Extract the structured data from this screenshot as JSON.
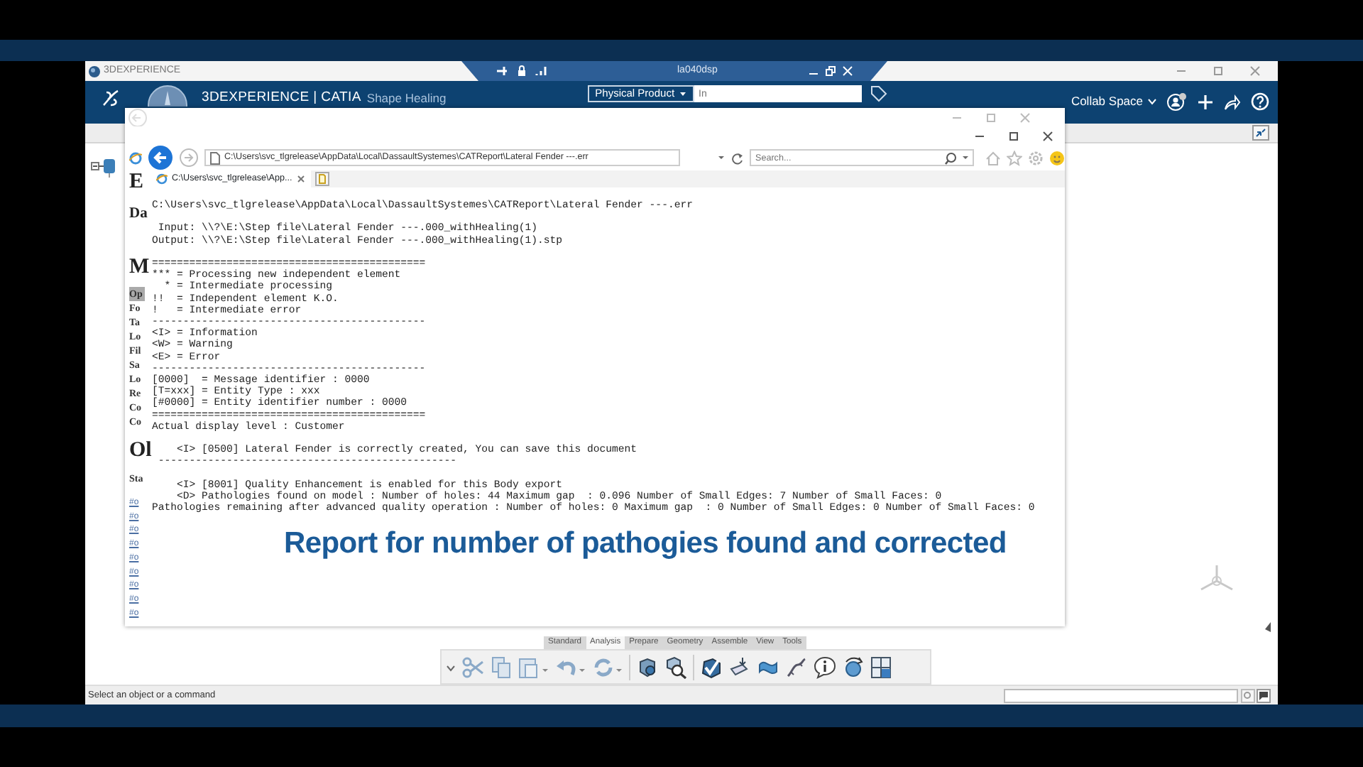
{
  "title_bar": {
    "app_name": "3DEXPERIENCE",
    "session": "la040dsp"
  },
  "app_header": {
    "brand": "3DEXPERIENCE | CATIA",
    "app": "Shape Healing",
    "search_scope": "Physical Product",
    "search_placeholder": "In",
    "collab_space": "Collab Space"
  },
  "browser": {
    "address": "C:\\Users\\svc_tlgrelease\\AppData\\Local\\DassaultSystemes\\CATReport\\Lateral Fender ---.err",
    "search_placeholder": "Search...",
    "tabs": [
      {
        "label": "C:\\Users\\svc_tlgrelease\\App...",
        "selected": true
      }
    ],
    "report_blocks": [
      [
        "C:\\Users\\svc_tlgrelease\\AppData\\Local\\DassaultSystemes\\CATReport\\Lateral Fender ---.err"
      ],
      [
        " Input: \\\\?\\E:\\Step file\\Lateral Fender ---.000_withHealing(1)",
        "Output: \\\\?\\E:\\Step file\\Lateral Fender ---.000_withHealing(1).stp"
      ],
      [
        "============================================",
        "*** = Processing new independent element",
        "  * = Intermediate processing",
        "!!  = Independent element K.O.",
        "!   = Intermediate error",
        "--------------------------------------------",
        "<I> = Information",
        "<W> = Warning",
        "<E> = Error",
        "--------------------------------------------",
        "[0000]  = Message identifier : 0000",
        "[T=xxx] = Entity Type : xxx",
        "[#0000] = Entity identifier number : 0000",
        "============================================",
        "Actual display level : Customer"
      ],
      [
        "    <I> [0500] Lateral Fender is correctly created, You can save this document",
        " ------------------------------------------------"
      ],
      [
        "    <I> [8001] Quality Enhancement is enabled for this Body export",
        "    <D> Pathologies found on model : Number of holes: 44 Maximum gap  : 0.096 Number of Small Edges: 7 Number of Small Faces: 0",
        "Pathologies remaining after advanced quality operation : Number of holes: 0 Maximum gap  : 0 Number of Small Edges: 0 Number of Small Faces: 0"
      ]
    ]
  },
  "background_page": {
    "headings": [
      {
        "text": "E",
        "kind": "title"
      },
      {
        "text": "Da",
        "kind": "heading"
      },
      {
        "text": "M",
        "kind": "title"
      },
      {
        "text": "Op",
        "kind": "highlight"
      },
      {
        "text": "Fo",
        "kind": "item"
      },
      {
        "text": "Ta",
        "kind": "item"
      },
      {
        "text": "Lo",
        "kind": "item"
      },
      {
        "text": "Fil",
        "kind": "item"
      },
      {
        "text": "Sa",
        "kind": "item"
      },
      {
        "text": "Lo",
        "kind": "item"
      },
      {
        "text": "Re",
        "kind": "item"
      },
      {
        "text": "Co",
        "kind": "item"
      },
      {
        "text": "Co",
        "kind": "item"
      },
      {
        "text": "Ol",
        "kind": "title"
      },
      {
        "text": "Sta",
        "kind": "sub"
      }
    ],
    "links": [
      "#o",
      "#o",
      "#o",
      "#o",
      "#o",
      "#o",
      "#o",
      "#o",
      "#o"
    ]
  },
  "caption": "Report for number of pathogies found and corrected",
  "toolbar": {
    "tabs": [
      {
        "label": "Standard",
        "selected": false
      },
      {
        "label": "Analysis",
        "selected": true
      },
      {
        "label": "Prepare",
        "selected": false
      },
      {
        "label": "Geometry",
        "selected": false
      },
      {
        "label": "Assemble",
        "selected": false
      },
      {
        "label": "View",
        "selected": false
      },
      {
        "label": "Tools",
        "selected": false
      }
    ]
  },
  "status_bar": {
    "prompt": "Select an object or a command"
  }
}
